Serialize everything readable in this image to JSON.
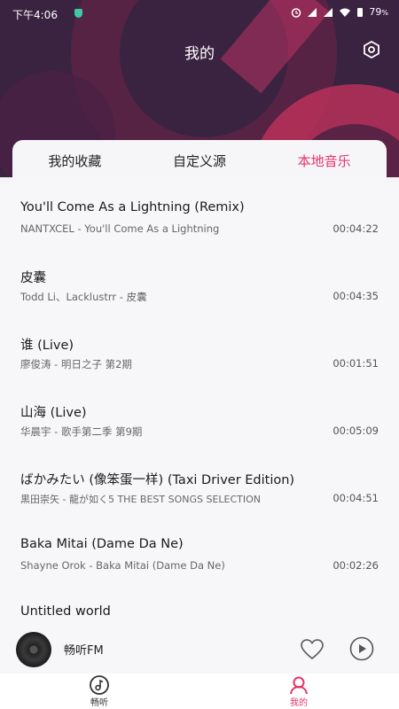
{
  "status_bar": {
    "time": "下午4:06",
    "battery": "79"
  },
  "header": {
    "title": "我的"
  },
  "tabs": [
    {
      "label": "我的收藏",
      "active": false
    },
    {
      "label": "自定义源",
      "active": false
    },
    {
      "label": "本地音乐",
      "active": true
    }
  ],
  "songs": [
    {
      "title": "You'll Come As a Lightning (Remix)",
      "subtitle": "NANTXCEL - You'll Come As a Lightning",
      "duration": "00:04:22"
    },
    {
      "title": "皮囊",
      "subtitle": "Todd Li、Lacklustrr - 皮囊",
      "duration": "00:04:35"
    },
    {
      "title": "谁 (Live)",
      "subtitle": "廖俊涛 - 明日之子 第2期",
      "duration": "00:01:51"
    },
    {
      "title": "山海 (Live)",
      "subtitle": "华晨宇 - 歌手第二季 第9期",
      "duration": "00:05:09"
    },
    {
      "title": "ばかみたい (像笨蛋一样) (Taxi Driver Edition)",
      "subtitle": "黒田崇矢 - 龍が如く5 THE BEST SONGS SELECTION",
      "duration": "00:04:51"
    },
    {
      "title": "Baka Mitai (Dame Da Ne)",
      "subtitle": "Shayne Orok - Baka Mitai (Dame Da Ne)",
      "duration": "00:02:26"
    },
    {
      "title": "Untitled world",
      "subtitle": "",
      "duration": ""
    }
  ],
  "player": {
    "title": "畅听FM"
  },
  "nav": [
    {
      "label": "畅听",
      "icon": "music-note-icon",
      "active": false
    },
    {
      "label": "我的",
      "icon": "person-icon",
      "active": true
    }
  ],
  "colors": {
    "accent": "#e6336a",
    "header_bg": "#3a2340"
  }
}
